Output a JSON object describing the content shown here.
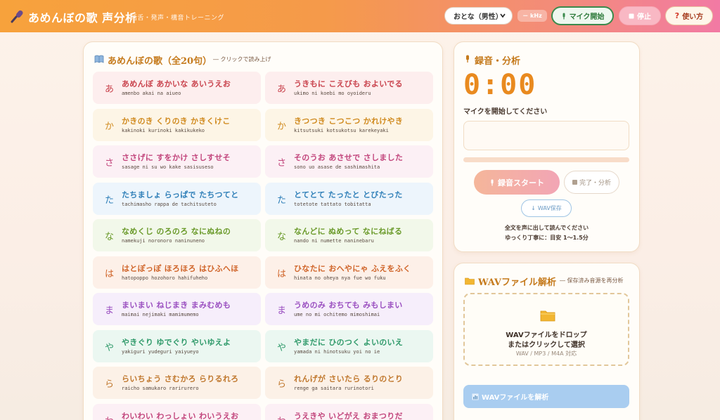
{
  "header": {
    "title": "あめんぼの歌 声分析",
    "subtitle": "活舌・発声・構音トレーニング",
    "voice_select": "おとな（男性）",
    "khz_badge": "－ kHz",
    "mic_start": "マイク開始",
    "stop": "停止",
    "help": "使い方"
  },
  "poem": {
    "title": "あめんぼの歌（全20句）",
    "note": "― クリックで読み上げ",
    "verses": [
      {
        "head": "あ",
        "text": "あめんぼ あかいな あいうえお",
        "romaji": "amenbo akai na aiueo",
        "color": "#c9434d",
        "bg": "#fdeeee"
      },
      {
        "head": "あ",
        "text": "うきもに こえびも およいでる",
        "romaji": "ukimo ni koebi mo oyoideru",
        "color": "#c9434d",
        "bg": "#fdeeee"
      },
      {
        "head": "か",
        "text": "かきのき くりのき かきくけこ",
        "romaji": "kakinoki kurinoki kakikukeko",
        "color": "#d08a1e",
        "bg": "#fdf5e6"
      },
      {
        "head": "か",
        "text": "きつつき こつこつ かれけやき",
        "romaji": "kitsutsuki kotsukotsu karekeyaki",
        "color": "#d08a1e",
        "bg": "#fdf5e6"
      },
      {
        "head": "さ",
        "text": "ささげに すをかけ さしすせそ",
        "romaji": "sasage ni su wo kake sasisuseso",
        "color": "#c2457c",
        "bg": "#fcf0f5"
      },
      {
        "head": "さ",
        "text": "そのうお あさせで さしました",
        "romaji": "sono uo asase de sashimashita",
        "color": "#c2457c",
        "bg": "#fcf0f5"
      },
      {
        "head": "た",
        "text": "たちましょ らっぱで たちつてと",
        "romaji": "tachimasho rappa de tachitsuteto",
        "color": "#2f7fb8",
        "bg": "#edf5fc"
      },
      {
        "head": "た",
        "text": "とてとて たったと とびたった",
        "romaji": "totetote tattato tobitatta",
        "color": "#2f7fb8",
        "bg": "#edf5fc"
      },
      {
        "head": "な",
        "text": "なめくじ のろのろ なにぬねの",
        "romaji": "namekuji noronoro naninuneno",
        "color": "#6a9a2a",
        "bg": "#f2f8ea"
      },
      {
        "head": "な",
        "text": "なんどに ぬめって なにねばる",
        "romaji": "nando ni numette naninebaru",
        "color": "#6a9a2a",
        "bg": "#f2f8ea"
      },
      {
        "head": "は",
        "text": "はとぽっぽ ほろほろ はひふへほ",
        "romaji": "hatopoppo hozohoro hahifuheho",
        "color": "#d0652a",
        "bg": "#fdf0e8"
      },
      {
        "head": "は",
        "text": "ひなたに おへやにゃ ふえをふく",
        "romaji": "hinata no oheya nya fue wo fuku",
        "color": "#d0652a",
        "bg": "#fdf0e8"
      },
      {
        "head": "ま",
        "text": "まいまい ねじまき まみむめも",
        "romaji": "maimai nejimaki mamimumemo",
        "color": "#9a4fc0",
        "bg": "#f6eefb"
      },
      {
        "head": "ま",
        "text": "うめのみ おちても みもしまい",
        "romaji": "ume no mi ochitemo mimoshimai",
        "color": "#9a4fc0",
        "bg": "#f6eefb"
      },
      {
        "head": "や",
        "text": "やきぐり ゆでぐり やいゆえよ",
        "romaji": "yakiguri yudeguri yaiyueyo",
        "color": "#2f9a6a",
        "bg": "#ebf7f1"
      },
      {
        "head": "や",
        "text": "やまだに ひのつく よいのいえ",
        "romaji": "yamada ni hinotsuku yoi no ie",
        "color": "#2f9a6a",
        "bg": "#ebf7f1"
      },
      {
        "head": "ら",
        "text": "らいちょう さむかろ らりるれろ",
        "romaji": "raicho samukaro rarirurero",
        "color": "#c0782e",
        "bg": "#fcf1e7"
      },
      {
        "head": "ら",
        "text": "れんげが さいたら るりのとり",
        "romaji": "renge ga saitara rurinotori",
        "color": "#c0782e",
        "bg": "#fcf1e7"
      },
      {
        "head": "わ",
        "text": "わいわい わっしょい わいうえお",
        "romaji": "",
        "color": "#c2457c",
        "bg": "#fcf0f5"
      },
      {
        "head": "わ",
        "text": "うえきや いどがえ おまつりだ",
        "romaji": "",
        "color": "#c2457c",
        "bg": "#fcf0f5"
      }
    ]
  },
  "recorder": {
    "title": "録音・分析",
    "timer": "0:00",
    "status": "マイクを開始してください",
    "level": 0,
    "start_label": "録音スタート",
    "done_label": "完了・分析",
    "wav_save_label": "WAV保存",
    "hint1": "全文を声に出して読んでください",
    "hint2": "ゆっくり丁寧に：目安 1〜1.5分"
  },
  "wav": {
    "title": "WAVファイル解析",
    "note": "― 保存済み音源を再分析",
    "drop1": "WAVファイルをドロップ",
    "drop2": "またはクリックして選択",
    "formats": "WAV / MP3 / M4A 対応",
    "analyze_label": "WAVファイルを解析"
  }
}
